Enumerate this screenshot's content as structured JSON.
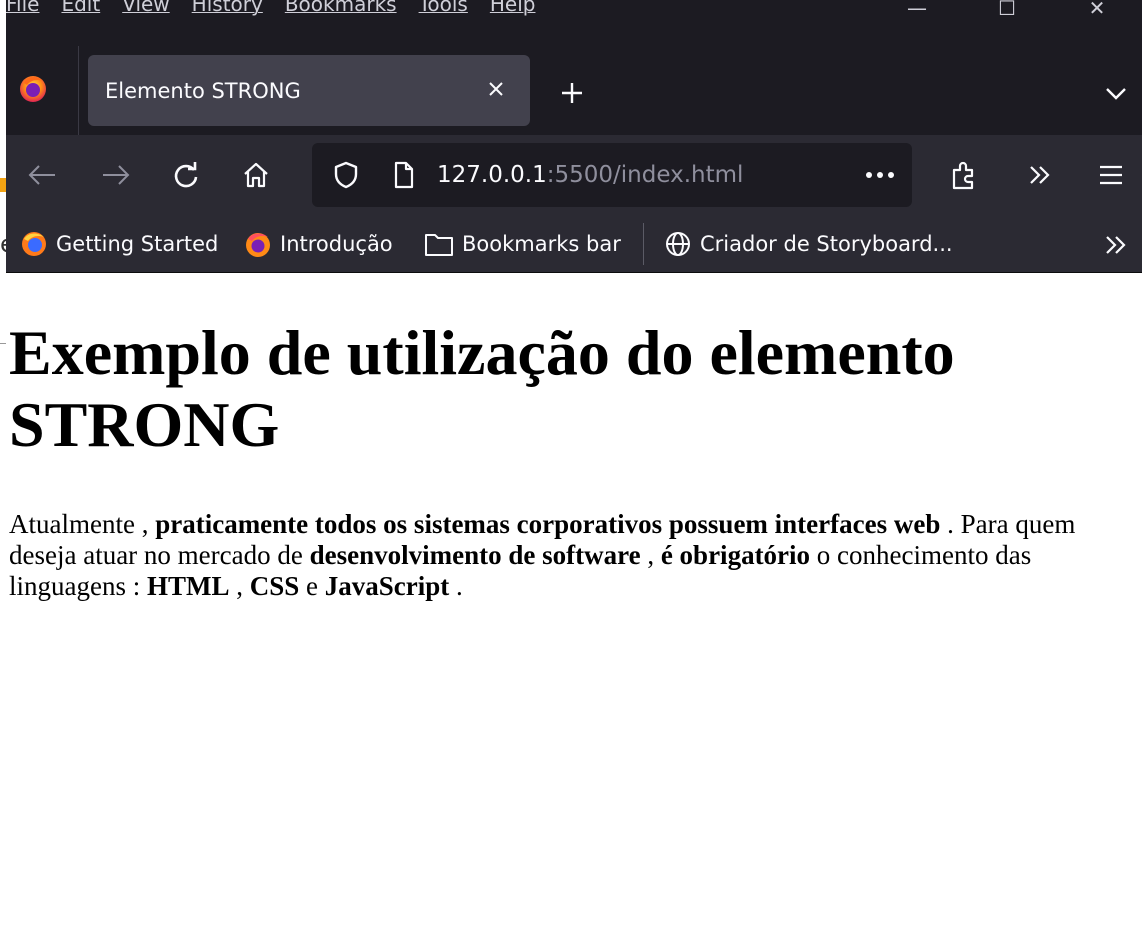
{
  "menubar": {
    "items": [
      "File",
      "Edit",
      "View",
      "History",
      "Bookmarks",
      "Tools",
      "Help"
    ]
  },
  "window_controls": {
    "minimize": "—",
    "maximize": "☐",
    "close": "✕"
  },
  "tab": {
    "title": "Elemento STRONG"
  },
  "address_bar": {
    "host": "127.0.0.1",
    "rest": ":5500/index.html"
  },
  "bookmarks": {
    "items": [
      {
        "label": "Getting Started",
        "icon": "firefox-blue-icon"
      },
      {
        "label": "Introdução",
        "icon": "firefox-icon"
      },
      {
        "label": "Bookmarks bar",
        "icon": "folder-icon"
      },
      {
        "label": "Criador de Storyboard...",
        "icon": "globe-icon"
      }
    ]
  },
  "page": {
    "heading": "Exemplo de utilização do elemento STRONG",
    "paragraph": {
      "t1": "Atualmente ,",
      "s1": "praticamente todos os sistemas corporativos possuem interfaces web",
      "t2": ". Para quem deseja atuar no mercado de",
      "s2": "desenvolvimento de software",
      "t3": ",",
      "s3": "é obrigatório",
      "t4": "o conhecimento das linguagens :",
      "s4": "HTML",
      "t5": ",",
      "s5": "CSS",
      "t6": "e",
      "s6": "JavaScript",
      "t7": "."
    }
  },
  "background": {
    "partial_text": "e"
  },
  "colors": {
    "toolbar_bg": "#2b2a33",
    "tabbar_bg": "#1c1b22",
    "active_tab_bg": "#42414d",
    "text_light": "#fbfbfe",
    "url_dim": "#8f8f9d",
    "accent_orange": "#f3a313"
  }
}
